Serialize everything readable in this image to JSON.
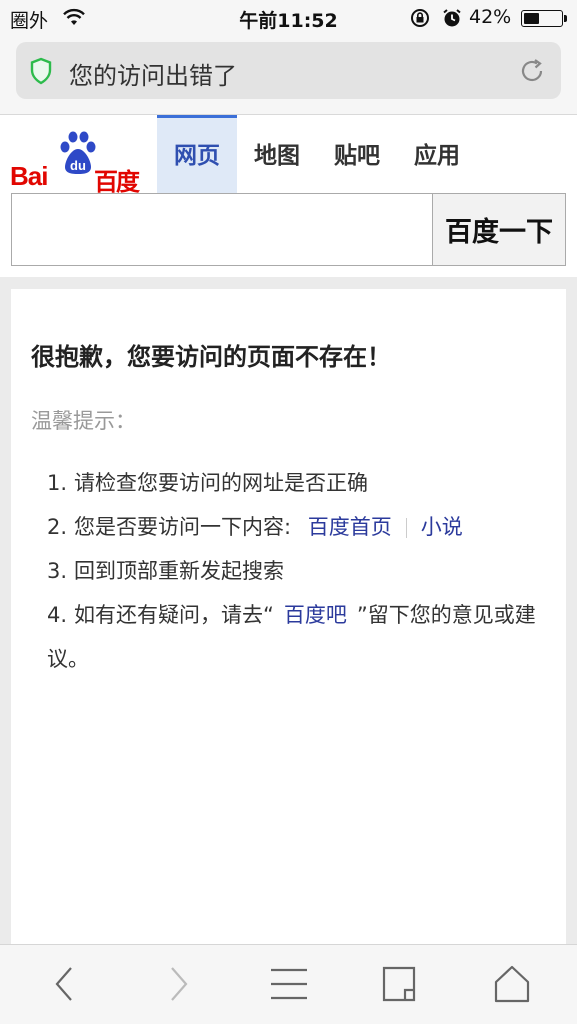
{
  "status_bar": {
    "carrier": "圈外",
    "time": "午前11:52",
    "battery_percent": "42%",
    "battery_level": 0.42
  },
  "address_bar": {
    "title": "您的访问出错了"
  },
  "baidu": {
    "logo": {
      "bai": "Bai",
      "paw_text": "du",
      "cn": "百度"
    },
    "tabs": [
      {
        "label": "网页",
        "active": true
      },
      {
        "label": "地图",
        "active": false
      },
      {
        "label": "贴吧",
        "active": false
      },
      {
        "label": "应用",
        "active": false
      }
    ],
    "search": {
      "value": "",
      "button_label": "百度一下"
    }
  },
  "error": {
    "heading": "很抱歉，您要访问的页面不存在！",
    "hint": "温馨提示：",
    "items": [
      {
        "num": "1.",
        "text": "请检查您要访问的网址是否正确"
      },
      {
        "num": "2.",
        "text": "您是否要访问一下内容:",
        "link1": "百度首页",
        "link2": "小说"
      },
      {
        "num": "3.",
        "text": "回到顶部重新发起搜索"
      },
      {
        "num": "4.",
        "text_before": "如有还有疑问，请去“",
        "link": "百度吧",
        "text_after": "”留下您的意见或建议。"
      }
    ]
  },
  "toolbar": {
    "icons": [
      "back-icon",
      "forward-icon",
      "menu-icon",
      "tabs-icon",
      "home-icon"
    ]
  }
}
